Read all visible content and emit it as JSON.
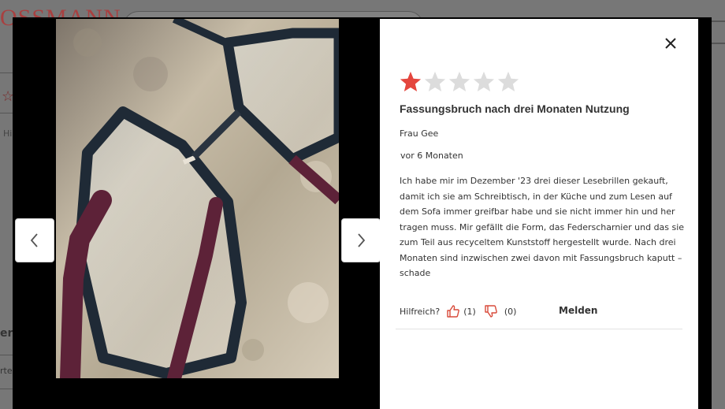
{
  "background": {
    "logo_text": "OSSMANN",
    "breadcrumb": "Hi",
    "side_heading": "ert",
    "side_text": "rte"
  },
  "modal": {
    "image_alt": "Kundenfoto: Lesebrille mit Fassungsbruch",
    "prev_icon": "chevron-left-icon",
    "next_icon": "chevron-right-icon",
    "close_icon": "close-icon"
  },
  "review": {
    "rating": 1,
    "max_rating": 5,
    "star_color_filled": "#e4463e",
    "star_color_empty": "#dcdcdc",
    "title": "Fassungsbruch nach drei Monaten Nutzung",
    "author": "Frau Gee",
    "date": "vor 6 Monaten",
    "text": "Ich habe mir im Dezember '23 drei dieser Lesebrillen gekauft, damit ich sie am Schreibtisch, in der Küche und zum Lesen auf dem Sofa immer greifbar habe und sie nicht immer hin und her tragen muss. Mir gefällt die Form, das Federscharnier und das sie zum Teil aus recyceltem Kunststoff hergestellt wurde. Nach drei Monaten sind inzwischen zwei davon mit Fassungsbruch kaputt – schade",
    "helpful_label": "Hilfreich?",
    "helpful_yes_count": "(1)",
    "helpful_no_count": "(0)",
    "report_label": "Melden"
  }
}
